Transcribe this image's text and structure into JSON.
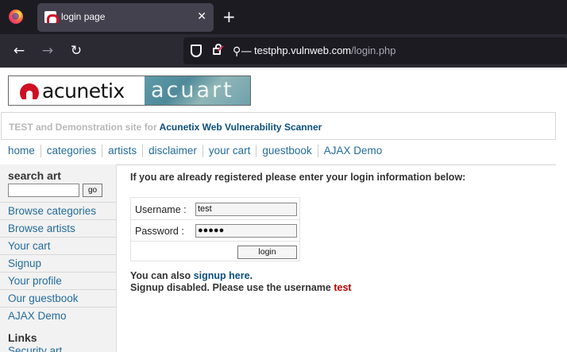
{
  "browser": {
    "tab_title": "login page",
    "close_glyph": "✕",
    "new_tab_glyph": "+",
    "url_host": "testphp.vulnweb.com",
    "url_path": "/login.php"
  },
  "header": {
    "logo_left_text": "acunetix",
    "logo_right_text": "acuart",
    "tagline_prefix": "TEST and Demonstration site for",
    "tagline_link": "Acunetix Web Vulnerability Scanner"
  },
  "topnav": {
    "items": [
      "home",
      "categories",
      "artists",
      "disclaimer",
      "your cart",
      "guestbook",
      "AJAX Demo"
    ]
  },
  "sidebar": {
    "search_title": "search art",
    "search_value": "",
    "go_label": "go",
    "items": [
      "Browse categories",
      "Browse artists",
      "Your cart",
      "Signup",
      "Your profile",
      "Our guestbook",
      "AJAX Demo"
    ],
    "links_title": "Links",
    "links_first": "Security art"
  },
  "main": {
    "intro": "If you are already registered please enter your login information below:",
    "username_label": "Username :",
    "username_value": "test",
    "password_label": "Password :",
    "password_value": "●●●●●",
    "login_label": "login",
    "signup_prefix": "You can also",
    "signup_link": "signup here",
    "signup_suffix": ".",
    "disabled_text": "Signup disabled. Please use the username",
    "disabled_user": "test"
  },
  "colors": {
    "link": "#246c9c",
    "dark_link": "#0b4f7d",
    "highlight_red": "#c00000",
    "chrome_bg": "#1c1b22"
  }
}
